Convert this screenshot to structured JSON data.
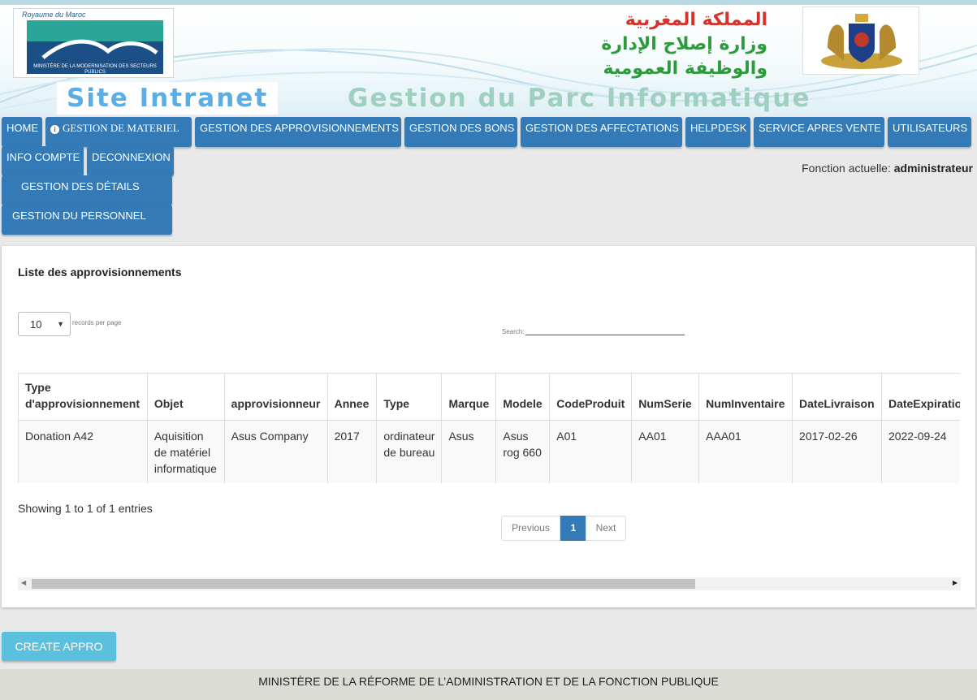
{
  "header": {
    "logo_kingdom": "Royaume du Maroc",
    "logo_ministry": "MINISTÈRE DE LA MODERNISATION DES SECTEURS PUBLICS",
    "arabic_line1": "المملكة المغربية",
    "arabic_line2": "وزارة إصلاح الإدارة",
    "arabic_line3": "والوظيفة العمومية",
    "site_title": "Site Intranet",
    "subtitle": "Gestion du Parc Informatique"
  },
  "nav": {
    "home": "HOME",
    "gestion_materiel": "GESTION DE MATERIEL",
    "gestion_appro": "GESTION DES APPROVISIONNEMENTS",
    "gestion_bons": "GESTION DES BONS",
    "gestion_affectations": "GESTION DES AFFECTATIONS",
    "helpdesk": "HELPDESK",
    "sav": "SERVICE APRES VENTE",
    "utilisateurs": "UTILISATEURS",
    "info_compte": "INFO COMPTE",
    "deconnexion": "DECONNEXION",
    "gestion_details": "GESTION DES DÉTAILS",
    "gestion_personnel": "GESTION DU PERSONNEL"
  },
  "fonction": {
    "label": "Fonction actuelle:",
    "value": "administrateur"
  },
  "panel": {
    "title": "Liste des approvisionnements",
    "length_value": "10",
    "length_label": "records per page",
    "search_label": "Search:",
    "showing": "Showing 1 to 1 of 1 entries"
  },
  "table": {
    "headers": [
      "Type d'approvisionnement",
      "Objet",
      "approvisionneur",
      "Annee",
      "Type",
      "Marque",
      "Modele",
      "CodeProduit",
      "NumSerie",
      "NumInventaire",
      "DateLivraison",
      "DateExpiration"
    ],
    "rows": [
      [
        "Donation A42",
        "Aquisition de matériel informatique",
        "Asus Company",
        "2017",
        "ordinateur de bureau",
        "Asus",
        "Asus rog 660",
        "A01",
        "AA01",
        "AAA01",
        "2017-02-26",
        "2022-09-24"
      ]
    ]
  },
  "pagination": {
    "previous": "Previous",
    "current": "1",
    "next": "Next"
  },
  "actions": {
    "create": "CREATE APPRO"
  },
  "footer": {
    "text": "MINISTÈRE DE LA RÉFORME DE L’ADMINISTRATION ET DE LA FONCTION PUBLIQUE"
  },
  "colors": {
    "primary": "#337ab7",
    "info": "#5bc0de",
    "title_red": "#d6322a",
    "title_green": "#2d9b3c"
  }
}
